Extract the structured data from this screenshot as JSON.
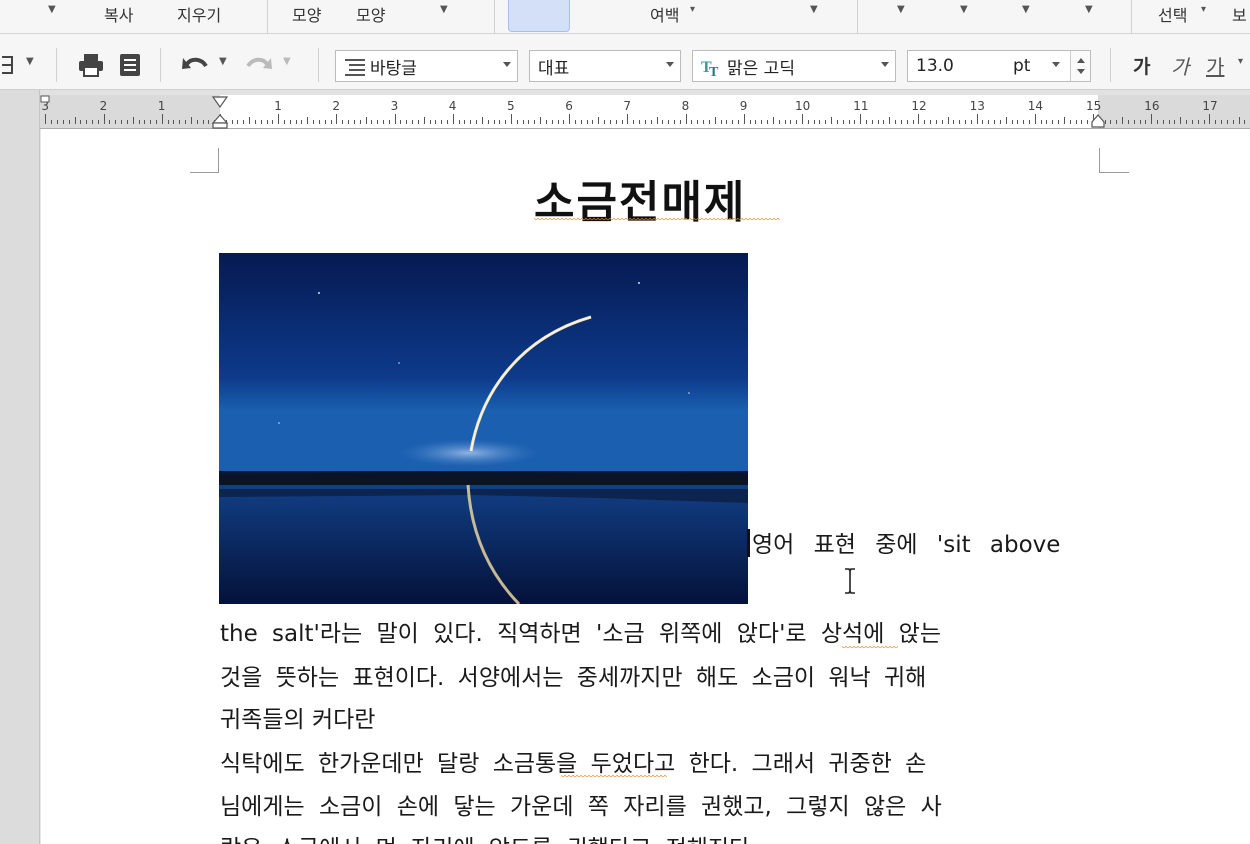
{
  "ribbon_top": {
    "items": [
      "복사",
      "지우기",
      "모양",
      "모양",
      "여백",
      "선택",
      "보"
    ]
  },
  "toolbar": {
    "style_value": "바탕글",
    "lang_value": "대표",
    "font_value": "맑은 고딕",
    "size_value": "13.0",
    "size_unit": "pt",
    "bold_label": "가",
    "italic_label": "가",
    "underline_label": "가"
  },
  "ruler": {
    "labels": [
      "3",
      "2",
      "1",
      "1",
      "2",
      "3",
      "4",
      "5",
      "6",
      "7",
      "8",
      "9",
      "10",
      "11",
      "12",
      "13",
      "14",
      "15",
      "16",
      "17"
    ]
  },
  "document": {
    "title": "소금전매제",
    "paragraph_lines": [
      "영어 표현 중에 'sit above",
      "the salt'라는 말이 있다. 직역하면 '소금 위쪽에 앉다'로 상석에 앉는",
      "것을 뜻하는 표현이다. 서양에서는 중세까지만 해도 소금이 워낙 귀해",
      "귀족들의 커다란",
      "식탁에도 한가운데만 달랑 소금통을 두었다고 한다. 그래서 귀중한 손",
      "님에게는 소금이 손에 닿는 가운데 쪽 자리를 권했고, 그렇지 않은 사",
      "람은 소금에서 먼 자리에 앉도록 권했다고 전해진다."
    ]
  },
  "colors": {
    "ribbon_bg": "#f6f6f6",
    "highlight": "#d3e0f7",
    "spell_squiggle": "#e8892a",
    "photo_sky": "#0a1f5a"
  }
}
